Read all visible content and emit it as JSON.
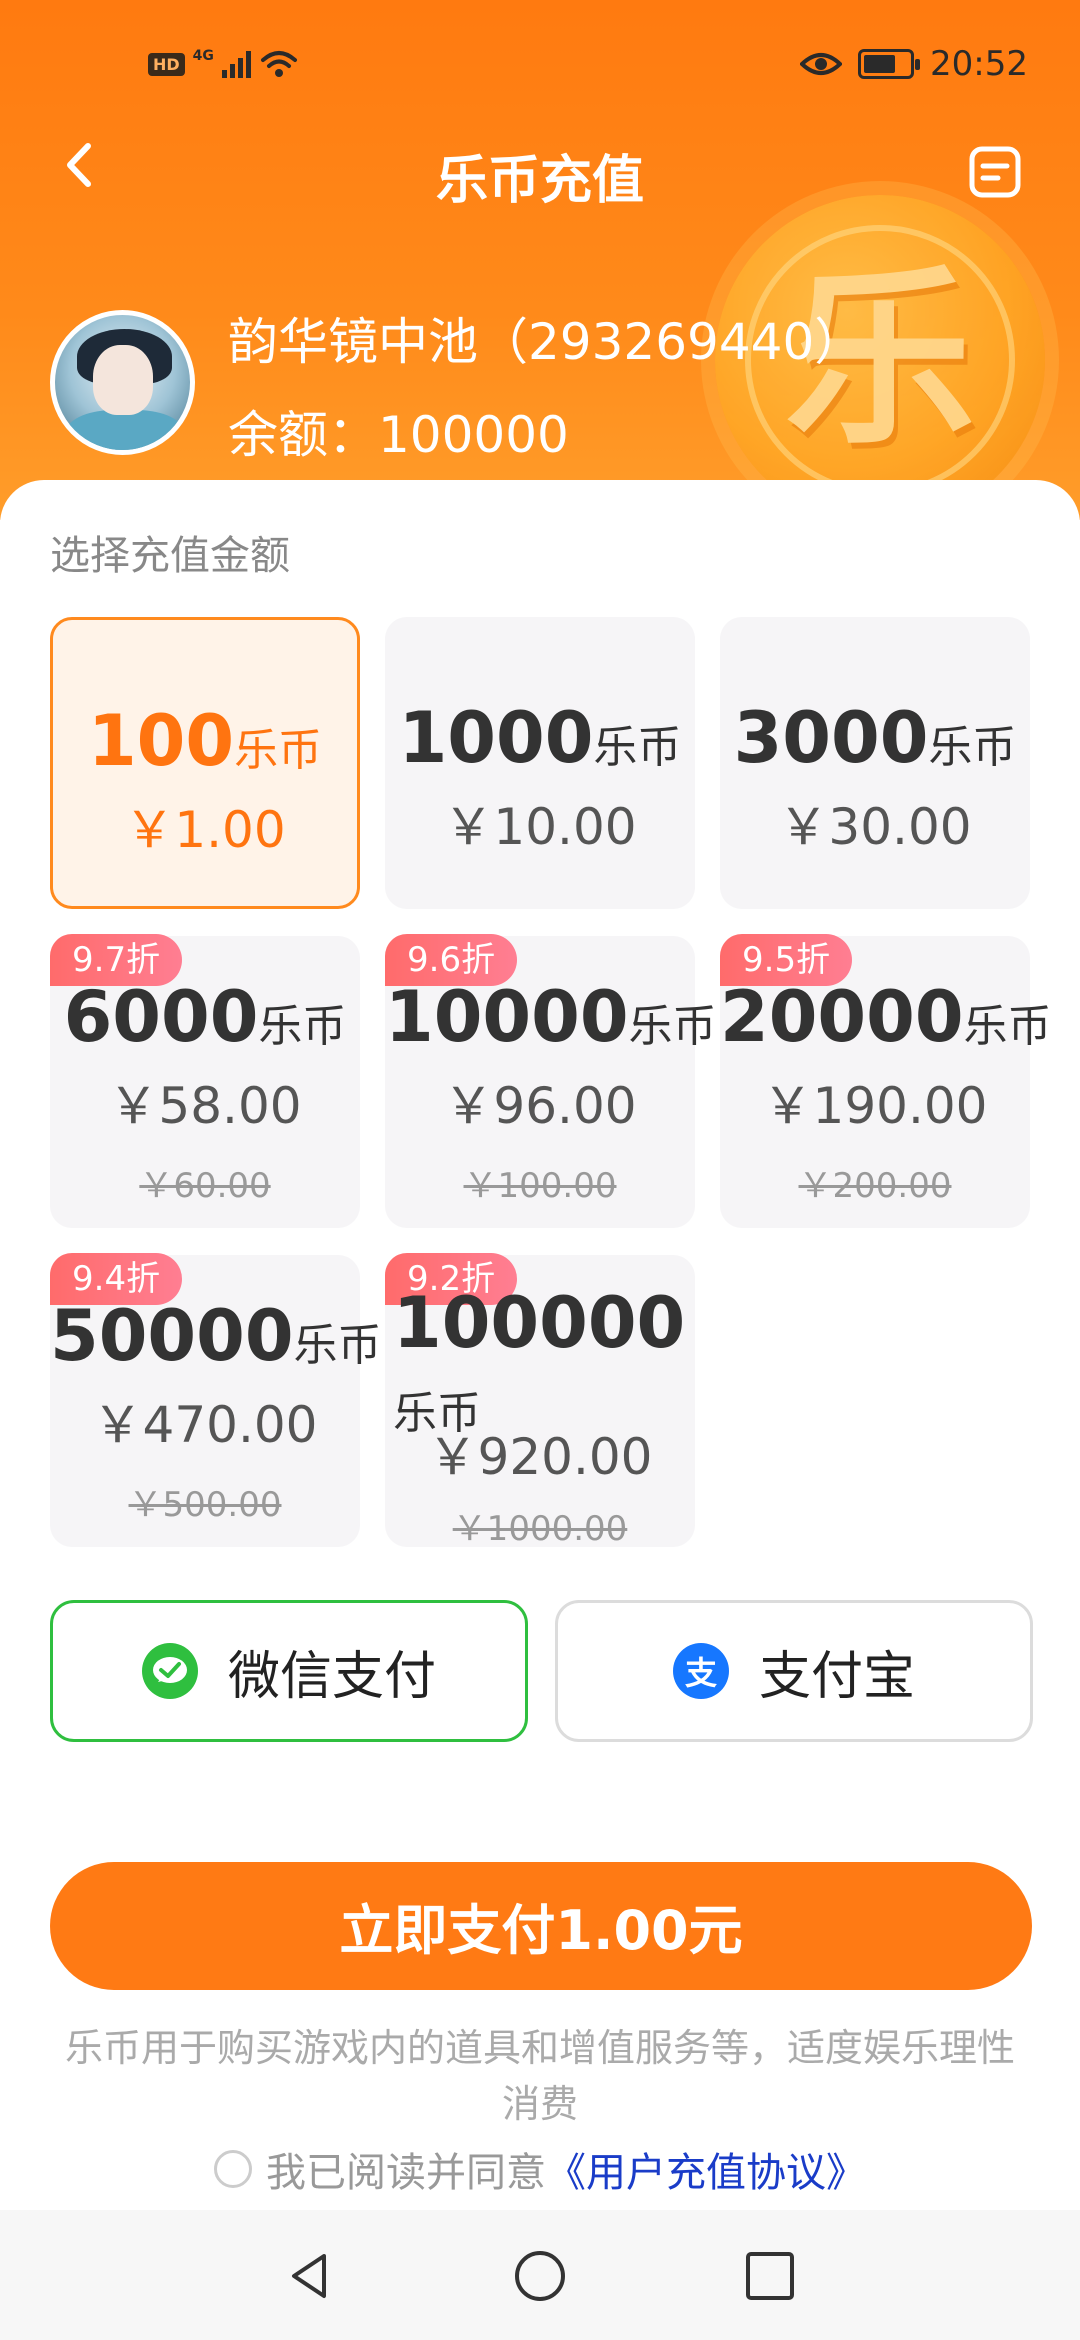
{
  "status_bar": {
    "hd": "HD",
    "network": "4G",
    "time": "20:52"
  },
  "header": {
    "title": "乐币充值",
    "coin_char": "乐"
  },
  "user": {
    "name": "韵华镜中池（293269440）",
    "balance_label": "余额：",
    "balance_value": "100000"
  },
  "section": {
    "label": "选择充值金额"
  },
  "packages": [
    {
      "coins": "100",
      "unit": "乐币",
      "price": "￥1.00",
      "original": "",
      "discount": "",
      "selected": true
    },
    {
      "coins": "1000",
      "unit": "乐币",
      "price": "￥10.00",
      "original": "",
      "discount": "",
      "selected": false
    },
    {
      "coins": "3000",
      "unit": "乐币",
      "price": "￥30.00",
      "original": "",
      "discount": "",
      "selected": false
    },
    {
      "coins": "6000",
      "unit": "乐币",
      "price": "￥58.00",
      "original": "￥60.00",
      "discount": "9.7折",
      "selected": false
    },
    {
      "coins": "10000",
      "unit": "乐币",
      "price": "￥96.00",
      "original": "￥100.00",
      "discount": "9.6折",
      "selected": false
    },
    {
      "coins": "20000",
      "unit": "乐币",
      "price": "￥190.00",
      "original": "￥200.00",
      "discount": "9.5折",
      "selected": false
    },
    {
      "coins": "50000",
      "unit": "乐币",
      "price": "￥470.00",
      "original": "￥500.00",
      "discount": "9.4折",
      "selected": false
    },
    {
      "coins": "100000",
      "unit": "乐币",
      "price": "￥920.00",
      "original": "￥1000.00",
      "discount": "9.2折",
      "selected": false
    }
  ],
  "payment": {
    "wechat_label": "微信支付",
    "alipay_label": "支付宝",
    "alipay_icon_char": "支",
    "selected": "wechat",
    "submit_label": "立即支付1.00元"
  },
  "notice": {
    "line1": "乐币用于购买游戏内的道具和增值服务等，适度娱乐理性",
    "line2": "消费"
  },
  "agreement": {
    "text": "我已阅读并同意",
    "link": "《用户充值协议》"
  },
  "colors": {
    "accent": "#ff7a14",
    "wechat": "#2fbf3f",
    "alipay": "#1677ff",
    "discount_badge": "#ff6b6b",
    "link": "#1a3cc8"
  }
}
